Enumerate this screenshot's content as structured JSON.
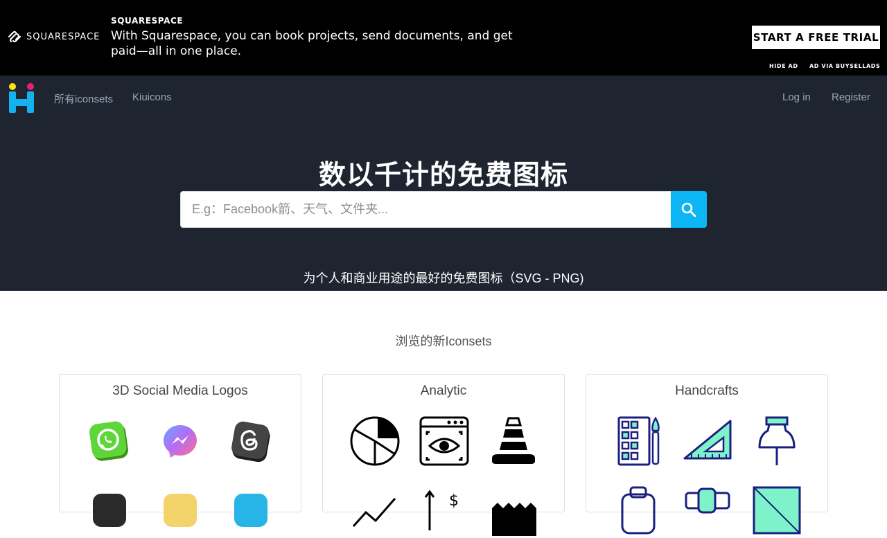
{
  "ad": {
    "logo_text": "SQUARESPACE",
    "brand": "SQUARESPACE",
    "copy": "With Squarespace, you can book projects, send documents, and get paid—all in one place.",
    "cta": "START A FREE TRIAL",
    "hide_ad": "HIDE AD",
    "via": "AD VIA BUYSELLADS"
  },
  "nav": {
    "logo_icon": "iconsets-logo",
    "links": [
      "所有iconsets",
      "Kiuicons"
    ],
    "login": "Log in",
    "register": "Register"
  },
  "hero": {
    "title": "数以千计的免费图标",
    "search_placeholder": "E.g：Facebook箭、天气、文件夹...",
    "search_icon": "search-icon",
    "subtitle": "为个人和商业用途的最好的免费图标（SVG - PNG)"
  },
  "section": {
    "title": "浏览的新Iconsets"
  },
  "cards": [
    {
      "title": "3D Social Media Logos",
      "icons": [
        "whatsapp-3d-icon",
        "messenger-3d-icon",
        "threads-3d-icon",
        "dark-3d-icon",
        "yellow-3d-icon",
        "blue-3d-icon"
      ]
    },
    {
      "title": "Analytic",
      "icons": [
        "pie-chart-icon",
        "web-view-eye-icon",
        "pyramid-icon",
        "line-graph-icon",
        "dollar-growth-icon",
        "ranking-icon"
      ]
    },
    {
      "title": "Handcrafts",
      "icons": [
        "palette-icon",
        "set-square-icon",
        "push-pin-icon",
        "bag-icon",
        "measuring-tape-icon",
        "cutting-mat-icon"
      ]
    }
  ],
  "colors": {
    "ad_bg": "#000000",
    "hero_bg": "#1e2530",
    "accent": "#0cb5f3",
    "logo_yellow": "#ffe11a",
    "logo_pink": "#ee1b7a",
    "handcraft_navy": "#1b1f7d",
    "handcraft_mint": "#7ef3c9"
  }
}
